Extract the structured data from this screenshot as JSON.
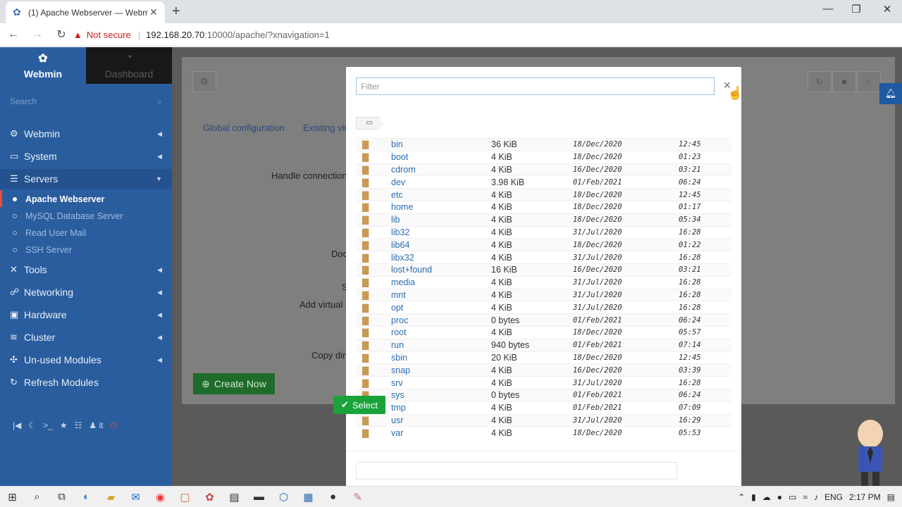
{
  "browser": {
    "tab_title": "(1) Apache Webserver — Webmin",
    "tab_close": "✕",
    "new_tab": "+",
    "window_controls": [
      "—",
      "❐",
      "✕"
    ],
    "security_label": "Not secure",
    "url_host": "192.168.20.70",
    "url_path": ":10000/apache/?xnavigation=1"
  },
  "sidebar": {
    "brand": "Webmin",
    "dashboard": "Dashboard",
    "search_placeholder": "Search",
    "menu": {
      "webmin": "Webmin",
      "system": "System",
      "servers": "Servers",
      "tools": "Tools",
      "networking": "Networking",
      "hardware": "Hardware",
      "cluster": "Cluster",
      "unused": "Un-used Modules",
      "refresh": "Refresh Modules"
    },
    "sub": {
      "apache": "Apache Webserver",
      "mysql": "MySQL Database Server",
      "mail": "Read User Mail",
      "ssh": "SSH Server"
    },
    "user_label": "it"
  },
  "main": {
    "tab_global": "Global configuration",
    "tab_existing": "Existing vir",
    "label_handle": "Handle connections",
    "label_doc": "Doc",
    "label_s": "S",
    "label_add": "Add virtual s",
    "label_copy": "Copy dire",
    "create_button": "Create Now"
  },
  "modal": {
    "filter_placeholder": "Filter",
    "close": "✕",
    "crumb": "▭",
    "select_button": "Select",
    "files": [
      {
        "name": "bin",
        "size": "36 KiB",
        "date": "18/Dec/2020",
        "time": "12:45"
      },
      {
        "name": "boot",
        "size": "4 KiB",
        "date": "18/Dec/2020",
        "time": "01:23"
      },
      {
        "name": "cdrom",
        "size": "4 KiB",
        "date": "16/Dec/2020",
        "time": "03:21"
      },
      {
        "name": "dev",
        "size": "3.98 KiB",
        "date": "01/Feb/2021",
        "time": "06:24"
      },
      {
        "name": "etc",
        "size": "4 KiB",
        "date": "18/Dec/2020",
        "time": "12:45"
      },
      {
        "name": "home",
        "size": "4 KiB",
        "date": "18/Dec/2020",
        "time": "01:17"
      },
      {
        "name": "lib",
        "size": "4 KiB",
        "date": "18/Dec/2020",
        "time": "05:34"
      },
      {
        "name": "lib32",
        "size": "4 KiB",
        "date": "31/Jul/2020",
        "time": "16:28"
      },
      {
        "name": "lib64",
        "size": "4 KiB",
        "date": "18/Dec/2020",
        "time": "01:22"
      },
      {
        "name": "libx32",
        "size": "4 KiB",
        "date": "31/Jul/2020",
        "time": "16:28"
      },
      {
        "name": "lost+found",
        "size": "16 KiB",
        "date": "16/Dec/2020",
        "time": "03:21"
      },
      {
        "name": "media",
        "size": "4 KiB",
        "date": "31/Jul/2020",
        "time": "16:28"
      },
      {
        "name": "mnt",
        "size": "4 KiB",
        "date": "31/Jul/2020",
        "time": "16:28"
      },
      {
        "name": "opt",
        "size": "4 KiB",
        "date": "31/Jul/2020",
        "time": "16:28"
      },
      {
        "name": "proc",
        "size": "0 bytes",
        "date": "01/Feb/2021",
        "time": "06:24"
      },
      {
        "name": "root",
        "size": "4 KiB",
        "date": "18/Dec/2020",
        "time": "05:57"
      },
      {
        "name": "run",
        "size": "940 bytes",
        "date": "01/Feb/2021",
        "time": "07:14"
      },
      {
        "name": "sbin",
        "size": "20 KiB",
        "date": "18/Dec/2020",
        "time": "12:45"
      },
      {
        "name": "snap",
        "size": "4 KiB",
        "date": "16/Dec/2020",
        "time": "03:39"
      },
      {
        "name": "srv",
        "size": "4 KiB",
        "date": "31/Jul/2020",
        "time": "16:28"
      },
      {
        "name": "sys",
        "size": "0 bytes",
        "date": "01/Feb/2021",
        "time": "06:24"
      },
      {
        "name": "tmp",
        "size": "4 KiB",
        "date": "01/Feb/2021",
        "time": "07:09"
      },
      {
        "name": "usr",
        "size": "4 KiB",
        "date": "31/Jul/2020",
        "time": "16:29"
      },
      {
        "name": "var",
        "size": "4 KiB",
        "date": "18/Dec/2020",
        "time": "05:53"
      }
    ]
  },
  "taskbar": {
    "language": "ENG",
    "clock": "2:17 PM"
  },
  "colors": {
    "sidebar": "#2a5d9e",
    "accent_green": "#1aa33a",
    "link_blue": "#2a6eb0",
    "warning_red": "#c5221f"
  }
}
